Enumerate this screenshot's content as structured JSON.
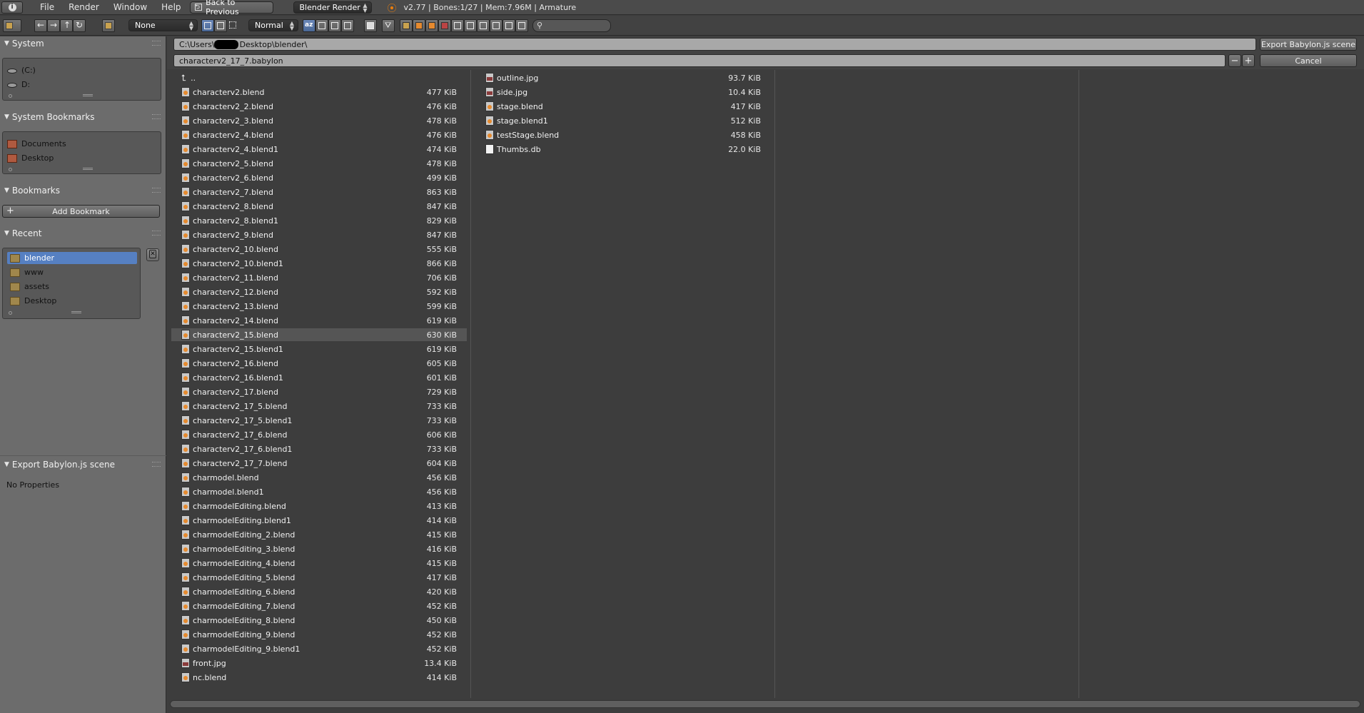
{
  "info_bar": {
    "menus": [
      "File",
      "Render",
      "Window",
      "Help"
    ],
    "back_button": "Back to Previous",
    "engine": "Blender Render",
    "stats": "v2.77 | Bones:1/27 | Mem:7.96M | Armature"
  },
  "toolbar": {
    "filter_none": "None",
    "display_mode": "Normal",
    "search_placeholder": ""
  },
  "left_panel": {
    "system": {
      "title": "System",
      "items": [
        "(C:)",
        "D:"
      ]
    },
    "system_bookmarks": {
      "title": "System Bookmarks",
      "items": [
        "Documents",
        "Desktop"
      ]
    },
    "bookmarks": {
      "title": "Bookmarks",
      "add_label": "Add Bookmark"
    },
    "recent": {
      "title": "Recent",
      "items": [
        "blender",
        "www",
        "assets",
        "Desktop"
      ],
      "selected": "blender"
    },
    "export_panel": {
      "title": "Export Babylon.js scene",
      "body": "No Properties"
    }
  },
  "path": {
    "directory": "C:\\Users\\          Desktop\\blender\\",
    "filename": "characterv2_17_7.babylon",
    "export_button": "Export Babylon.js scene",
    "cancel_button": "Cancel"
  },
  "files": {
    "parent": "..",
    "column1": [
      {
        "name": "characterv2.blend",
        "size": "477 KiB",
        "type": "blend"
      },
      {
        "name": "characterv2_2.blend",
        "size": "476 KiB",
        "type": "blend"
      },
      {
        "name": "characterv2_3.blend",
        "size": "478 KiB",
        "type": "blend"
      },
      {
        "name": "characterv2_4.blend",
        "size": "476 KiB",
        "type": "blend"
      },
      {
        "name": "characterv2_4.blend1",
        "size": "474 KiB",
        "type": "blend"
      },
      {
        "name": "characterv2_5.blend",
        "size": "478 KiB",
        "type": "blend"
      },
      {
        "name": "characterv2_6.blend",
        "size": "499 KiB",
        "type": "blend"
      },
      {
        "name": "characterv2_7.blend",
        "size": "863 KiB",
        "type": "blend"
      },
      {
        "name": "characterv2_8.blend",
        "size": "847 KiB",
        "type": "blend"
      },
      {
        "name": "characterv2_8.blend1",
        "size": "829 KiB",
        "type": "blend"
      },
      {
        "name": "characterv2_9.blend",
        "size": "847 KiB",
        "type": "blend"
      },
      {
        "name": "characterv2_10.blend",
        "size": "555 KiB",
        "type": "blend"
      },
      {
        "name": "characterv2_10.blend1",
        "size": "866 KiB",
        "type": "blend"
      },
      {
        "name": "characterv2_11.blend",
        "size": "706 KiB",
        "type": "blend"
      },
      {
        "name": "characterv2_12.blend",
        "size": "592 KiB",
        "type": "blend"
      },
      {
        "name": "characterv2_13.blend",
        "size": "599 KiB",
        "type": "blend"
      },
      {
        "name": "characterv2_14.blend",
        "size": "619 KiB",
        "type": "blend"
      },
      {
        "name": "characterv2_15.blend",
        "size": "630 KiB",
        "type": "blend",
        "highlighted": true
      },
      {
        "name": "characterv2_15.blend1",
        "size": "619 KiB",
        "type": "blend"
      },
      {
        "name": "characterv2_16.blend",
        "size": "605 KiB",
        "type": "blend"
      },
      {
        "name": "characterv2_16.blend1",
        "size": "601 KiB",
        "type": "blend"
      },
      {
        "name": "characterv2_17.blend",
        "size": "729 KiB",
        "type": "blend"
      },
      {
        "name": "characterv2_17_5.blend",
        "size": "733 KiB",
        "type": "blend"
      },
      {
        "name": "characterv2_17_5.blend1",
        "size": "733 KiB",
        "type": "blend"
      },
      {
        "name": "characterv2_17_6.blend",
        "size": "606 KiB",
        "type": "blend"
      },
      {
        "name": "characterv2_17_6.blend1",
        "size": "733 KiB",
        "type": "blend"
      },
      {
        "name": "characterv2_17_7.blend",
        "size": "604 KiB",
        "type": "blend"
      },
      {
        "name": "charmodel.blend",
        "size": "456 KiB",
        "type": "blend"
      },
      {
        "name": "charmodel.blend1",
        "size": "456 KiB",
        "type": "blend"
      },
      {
        "name": "charmodelEditing.blend",
        "size": "413 KiB",
        "type": "blend"
      },
      {
        "name": "charmodelEditing.blend1",
        "size": "414 KiB",
        "type": "blend"
      },
      {
        "name": "charmodelEditing_2.blend",
        "size": "415 KiB",
        "type": "blend"
      },
      {
        "name": "charmodelEditing_3.blend",
        "size": "416 KiB",
        "type": "blend"
      },
      {
        "name": "charmodelEditing_4.blend",
        "size": "415 KiB",
        "type": "blend"
      },
      {
        "name": "charmodelEditing_5.blend",
        "size": "417 KiB",
        "type": "blend"
      },
      {
        "name": "charmodelEditing_6.blend",
        "size": "420 KiB",
        "type": "blend"
      },
      {
        "name": "charmodelEditing_7.blend",
        "size": "452 KiB",
        "type": "blend"
      },
      {
        "name": "charmodelEditing_8.blend",
        "size": "450 KiB",
        "type": "blend"
      },
      {
        "name": "charmodelEditing_9.blend",
        "size": "452 KiB",
        "type": "blend"
      },
      {
        "name": "charmodelEditing_9.blend1",
        "size": "452 KiB",
        "type": "blend"
      },
      {
        "name": "front.jpg",
        "size": "13.4 KiB",
        "type": "image"
      },
      {
        "name": "nc.blend",
        "size": "414 KiB",
        "type": "blend"
      }
    ],
    "column2": [
      {
        "name": "outline.jpg",
        "size": "93.7 KiB",
        "type": "image"
      },
      {
        "name": "side.jpg",
        "size": "10.4 KiB",
        "type": "image"
      },
      {
        "name": "stage.blend",
        "size": "417 KiB",
        "type": "blend"
      },
      {
        "name": "stage.blend1",
        "size": "512 KiB",
        "type": "blend"
      },
      {
        "name": "testStage.blend",
        "size": "458 KiB",
        "type": "blend"
      },
      {
        "name": "Thumbs.db",
        "size": "22.0 KiB",
        "type": "text"
      }
    ]
  }
}
